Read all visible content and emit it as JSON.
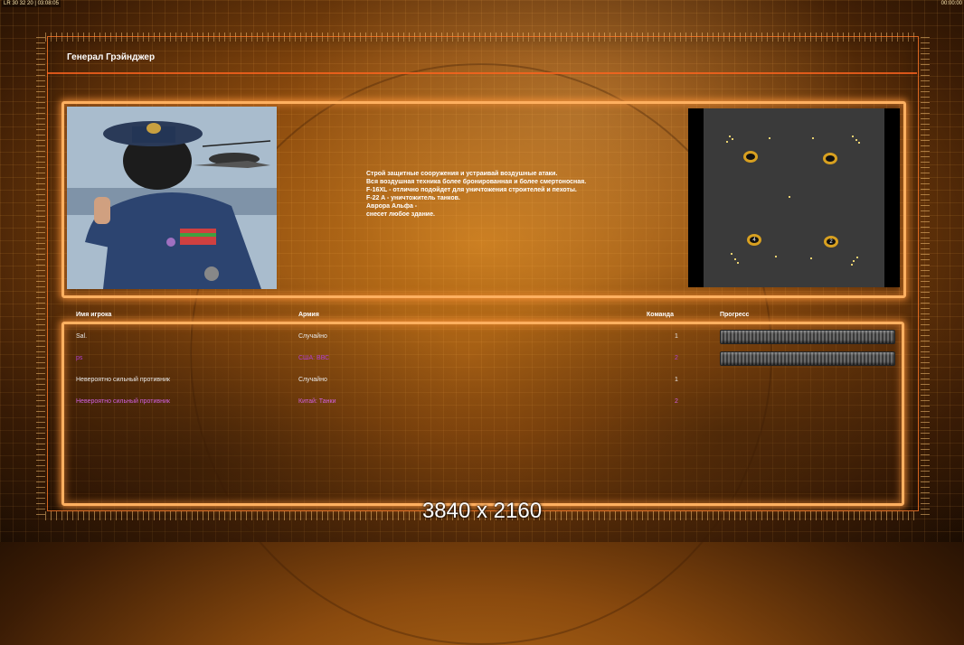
{
  "topbar": {
    "left_text": "LR 30 32 20 | 03:08:05",
    "right_text": "00:00:00"
  },
  "title": "Генерал Грэйнджер",
  "description": [
    "Строй защитные сооружения и устраивай воздушные атаки.",
    "Вся воздушная техника более бронированная и более смертоносная.",
    "F-16XL - отлично подойдет для уничтожения строителей и пехоты.",
    "F-22 A - уничтожитель танков.",
    "Аврора Альфа -",
    "снесет любое здание."
  ],
  "minimap": {
    "bases": [
      {
        "label": ""
      },
      {
        "label": ""
      },
      {
        "label": "4"
      },
      {
        "label": "2"
      }
    ]
  },
  "table": {
    "headers": {
      "player": "Имя игрока",
      "army": "Армия",
      "team": "Команда",
      "progress": "Прогресс"
    },
    "rows": [
      {
        "player": "Sal.",
        "army": "Случайно",
        "team": "1",
        "color": "#e8e8e8",
        "progress": 1.0
      },
      {
        "player": "ps",
        "army": "США: ВВС",
        "team": "2",
        "color": "#b040d0",
        "progress": 1.0
      },
      {
        "player": "Невероятно сильный противник",
        "army": "Случайно",
        "team": "1",
        "color": "#e8e8e8",
        "progress": null
      },
      {
        "player": "Невероятно сильный противник",
        "army": "Китай: Танки",
        "team": "2",
        "color": "#d060e0",
        "progress": null
      }
    ]
  },
  "resolution_label": "3840 x 2160",
  "colors": {
    "panel_border": "#ffb060",
    "frame_line": "#ff6a1e",
    "base_ring": "#d8a020"
  }
}
